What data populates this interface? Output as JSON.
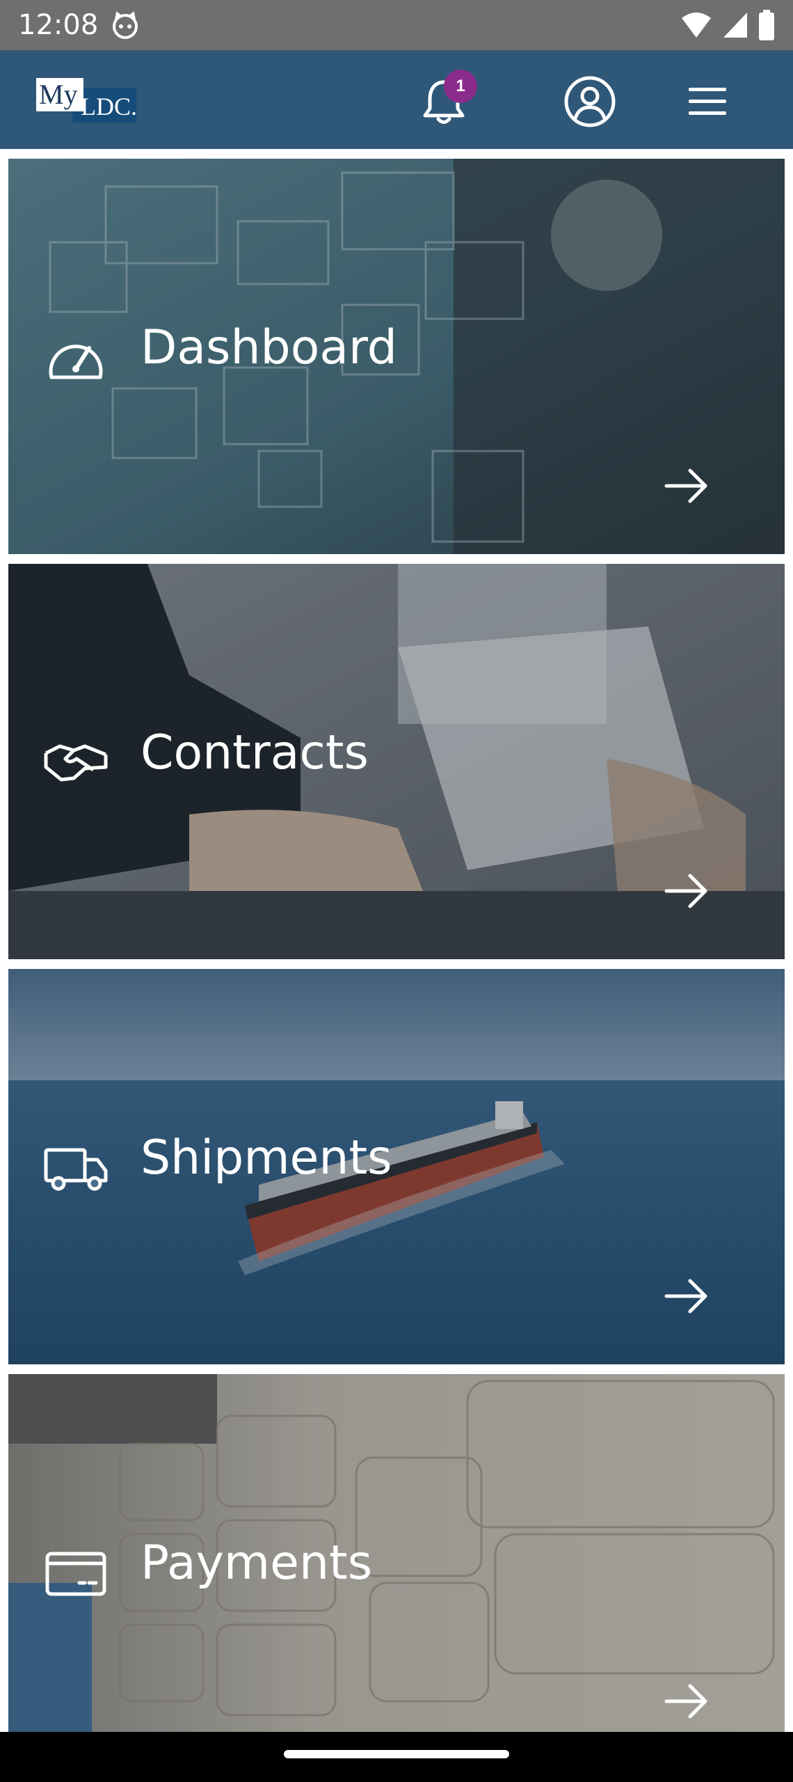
{
  "status_bar": {
    "time": "12:08",
    "icons": [
      "cat-face-icon",
      "wifi-icon",
      "cell-signal-icon",
      "battery-icon"
    ]
  },
  "app_bar": {
    "logo": {
      "my": "My",
      "ldc": "LDC."
    },
    "notifications": {
      "icon": "bell-icon",
      "count": "1"
    },
    "profile_icon": "user-circle-icon",
    "menu_icon": "hamburger-menu-icon",
    "colors": {
      "background": "#2f5778",
      "badge": "#8b2c8c"
    }
  },
  "tiles": [
    {
      "label": "Dashboard",
      "icon": "speedometer-icon",
      "arrow": "arrow-right-icon"
    },
    {
      "label": "Contracts",
      "icon": "handshake-icon",
      "arrow": "arrow-right-icon"
    },
    {
      "label": "Shipments",
      "icon": "truck-icon",
      "arrow": "arrow-right-icon"
    },
    {
      "label": "Payments",
      "icon": "credit-card-icon",
      "arrow": "arrow-right-icon"
    }
  ]
}
